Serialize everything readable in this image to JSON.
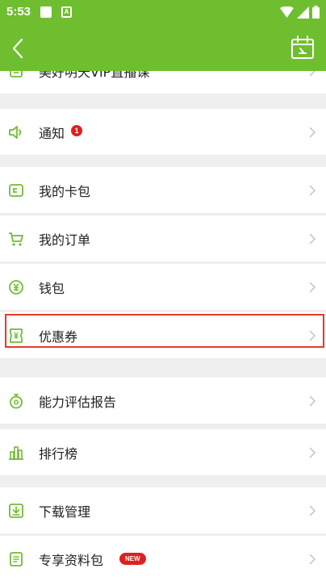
{
  "status_bar": {
    "time": "5:53",
    "notif_letter": "A"
  },
  "header": {
    "back_icon": "chevron-left-icon",
    "calendar_icon": "calendar-icon"
  },
  "colors": {
    "brand": "#6fbe30",
    "accent_red": "#e02020",
    "highlight_border": "#e53929",
    "divider": "#efefef"
  },
  "menu": {
    "items": [
      {
        "label": "美好明天VIP直播课",
        "icon": "vip-live-icon"
      },
      {
        "label": "通知",
        "icon": "speaker-icon",
        "badge": "1"
      },
      {
        "label": "我的卡包",
        "icon": "wallet-card-icon"
      },
      {
        "label": "我的订单",
        "icon": "cart-icon"
      },
      {
        "label": "钱包",
        "icon": "yen-coin-icon"
      },
      {
        "label": "优惠券",
        "icon": "coupon-icon"
      },
      {
        "label": "能力评估报告",
        "icon": "stopwatch-icon",
        "highlighted": true
      },
      {
        "label": "排行榜",
        "icon": "bar-chart-icon"
      },
      {
        "label": "下载管理",
        "icon": "download-icon"
      },
      {
        "label": "专享资料包",
        "icon": "document-icon",
        "badge": "NEW"
      }
    ]
  }
}
